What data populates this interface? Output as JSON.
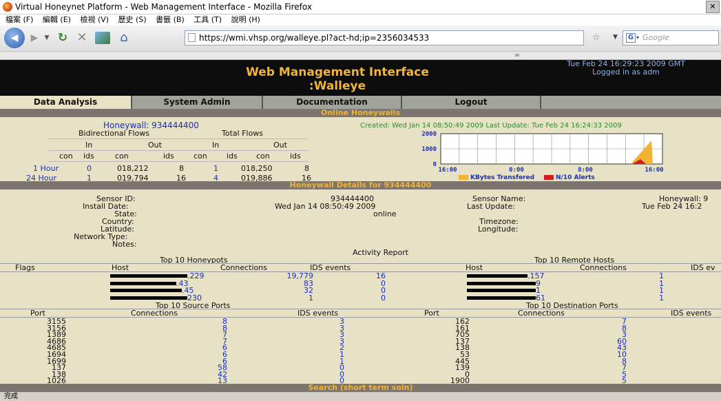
{
  "browser": {
    "window_title": "Virtual Honeynet Platform - Web Management Interface - Mozilla Firefox",
    "menu": [
      "檔案 (F)",
      "編輯 (E)",
      "檢視 (V)",
      "歷史 (S)",
      "書籤 (B)",
      "工具 (T)",
      "說明 (H)"
    ],
    "url": "https://wmi.vhsp.org/walleye.pl?act-hd;ip=2356034533",
    "search_placeholder": "Google",
    "status_text": "完成"
  },
  "banner": {
    "title_line1": "Web Management Interface",
    "title_line2": ":Walleye",
    "datetime": "Tue Feb 24 16:29:23 2009 GMT",
    "logged_in": "Logged in as adm"
  },
  "nav": [
    "Data Analysis",
    "System Admin",
    "Documentation",
    "Logout"
  ],
  "online_honeywalls": {
    "header": "Online Honeywalls",
    "honeywall_label": "Honeywall: 934444400",
    "bidirectional": "Bidirectional Flows",
    "total": "Total Flows",
    "in": "In",
    "out": "Out",
    "con": "con",
    "ids": "ids",
    "rows": [
      {
        "label": "1 Hour",
        "bi_in_con": "0",
        "bi_out_con": "018,212",
        "bi_out_ids": "8",
        "tot_in_con": "1",
        "tot_out_con": "018,250",
        "tot_out_ids": "8"
      },
      {
        "label": "24 Hour",
        "bi_in_con": "1",
        "bi_out_con": "019,794",
        "bi_out_ids": "16",
        "tot_in_con": "4",
        "tot_out_con": "019,886",
        "tot_out_ids": "16"
      }
    ],
    "created_text": "Created: Wed Jan 14 08:50:49 2009 Last Update: Tue Feb 24 16:24:33 2009"
  },
  "chart_data": {
    "type": "area",
    "y_ticks": [
      "2000",
      "1000",
      "0"
    ],
    "x_ticks": [
      "16:00",
      "0:00",
      "8:00",
      "16:00"
    ],
    "ylim": [
      0,
      2000
    ],
    "legend": [
      "KBytes Transfered",
      "N/10 Alerts"
    ],
    "colors": {
      "kbytes": "#f2b233",
      "alerts": "#d41c1c"
    }
  },
  "details": {
    "header": "Honeywall Details for 934444400",
    "sensor_id_label": "Sensor ID:",
    "sensor_id": "934444400",
    "install_date_label": "Install Date:",
    "install_date": "Wed Jan 14 08:50:49 2009",
    "state_label": "State:",
    "state": "online",
    "country_label": "Country:",
    "latitude_label": "Latitude:",
    "network_type_label": "Network Type:",
    "notes_label": "Notes:",
    "sensor_name_label": "Sensor Name:",
    "sensor_name": "Honeywall: 9",
    "last_update_label": "Last Update:",
    "last_update": "Tue Feb 24 16:2",
    "timezone_label": "Timezone:",
    "longitude_label": "Longitude:"
  },
  "activity": {
    "title": "Activity Report",
    "top_honeypots_title": "Top 10 Honeypots",
    "top_remote_title": "Top 10 Remote Hosts",
    "col_flags": "Flags",
    "col_host": "Host",
    "col_connections": "Connections",
    "col_ids": "IDS events",
    "col_ids_cut": "IDS ev",
    "honeypots": [
      {
        "host": ".229",
        "connections": "19,779",
        "ids": "16"
      },
      {
        "host": ".43",
        "connections": "83",
        "ids": "0"
      },
      {
        "host": ".45",
        "connections": "32",
        "ids": "0"
      },
      {
        "host": "230",
        "connections": "1",
        "ids": "0"
      }
    ],
    "remote_hosts": [
      {
        "host": ".157",
        "connections": "1"
      },
      {
        "host": "9",
        "connections": "1"
      },
      {
        "host": "1",
        "connections": "1"
      },
      {
        "host": "61",
        "connections": "1"
      }
    ],
    "top_src_title": "Top 10 Source Ports",
    "top_dst_title": "Top 10 Destination Ports",
    "col_port": "Port",
    "col_ids_events": "IDS events",
    "src_ports": [
      {
        "port": "3155",
        "connections": "8",
        "ids": "3"
      },
      {
        "port": "3156",
        "connections": "8",
        "ids": "3"
      },
      {
        "port": "1389",
        "connections": "7",
        "ids": "3"
      },
      {
        "port": "4686",
        "connections": "7",
        "ids": "3"
      },
      {
        "port": "4685",
        "connections": "6",
        "ids": "2"
      },
      {
        "port": "1694",
        "connections": "6",
        "ids": "1"
      },
      {
        "port": "1699",
        "connections": "6",
        "ids": "1"
      },
      {
        "port": "137",
        "connections": "58",
        "ids": "0"
      },
      {
        "port": "138",
        "connections": "42",
        "ids": "0"
      },
      {
        "port": "1026",
        "connections": "13",
        "ids": "0"
      }
    ],
    "dst_ports": [
      {
        "port": "162",
        "connections": "7"
      },
      {
        "port": "161",
        "connections": "8"
      },
      {
        "port": "705",
        "connections": "3"
      },
      {
        "port": "137",
        "connections": "60"
      },
      {
        "port": "138",
        "connections": "43"
      },
      {
        "port": "53",
        "connections": "10"
      },
      {
        "port": "445",
        "connections": "8"
      },
      {
        "port": "139",
        "connections": "7"
      },
      {
        "port": "0",
        "connections": "5"
      },
      {
        "port": "1900",
        "connections": "5"
      }
    ],
    "search_footer": "Search (short term soln)"
  }
}
